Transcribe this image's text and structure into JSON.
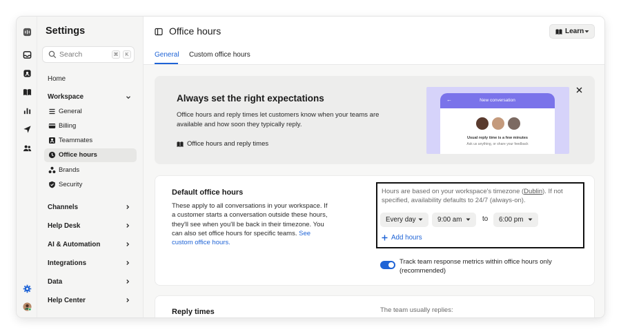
{
  "sidebar": {
    "title": "Settings",
    "search": {
      "placeholder": "Search",
      "shortcut_keys": [
        "⌘",
        "K"
      ]
    },
    "home_label": "Home",
    "workspace": {
      "label": "Workspace",
      "items": [
        {
          "label": "General",
          "icon": "lines-icon"
        },
        {
          "label": "Billing",
          "icon": "card-icon"
        },
        {
          "label": "Teammates",
          "icon": "id-badge-icon"
        },
        {
          "label": "Office hours",
          "icon": "clock-icon",
          "active": true
        },
        {
          "label": "Brands",
          "icon": "shapes-icon"
        },
        {
          "label": "Security",
          "icon": "shield-icon"
        }
      ]
    },
    "sections": [
      "Channels",
      "Help Desk",
      "AI & Automation",
      "Integrations",
      "Data",
      "Help Center"
    ]
  },
  "rail_icons": [
    "app-logo-icon",
    "inbox-icon",
    "contacts-icon",
    "knowledge-book-icon",
    "reports-icon",
    "outbound-icon",
    "team-icon",
    "settings-gear-icon",
    "user-avatar-icon"
  ],
  "header": {
    "title": "Office hours",
    "learn_label": "Learn"
  },
  "tabs": [
    {
      "label": "General",
      "active": true
    },
    {
      "label": "Custom office hours",
      "active": false
    }
  ],
  "banner": {
    "title": "Always set the right expectations",
    "description": "Office hours and reply times let customers know when your teams are available and how soon they typically reply.",
    "link_label": "Office hours and reply times",
    "preview": {
      "header_title": "New conversation",
      "reply_time": "Usual reply time is a few minutes",
      "subtitle": "Ask us anything, or share your feedback"
    }
  },
  "default_hours": {
    "title": "Default office hours",
    "description": "These apply to all conversations in your workspace. If a customer starts a conversation outside these hours, they'll see when you'll be back in their timezone. You can also set office hours for specific teams.",
    "description_link": "See custom office hours.",
    "timezone_note_before": "Hours are based on your workspace's timezone (",
    "timezone_name": "Dublin",
    "timezone_note_after": "). If not specified, availability defaults to 24/7 (always-on).",
    "day_value": "Every day",
    "start_value": "9:00 am",
    "to_label": "to",
    "end_value": "6:00 pm",
    "add_hours_label": "Add hours",
    "track_label": "Track team response metrics within office hours only (recommended)",
    "track_enabled": true
  },
  "reply_times": {
    "title": "Reply times",
    "note": "The team usually replies:"
  },
  "colors": {
    "accent": "#1e63d6",
    "preview_bg": "#d6d3fa",
    "preview_header": "#7a73ea"
  }
}
